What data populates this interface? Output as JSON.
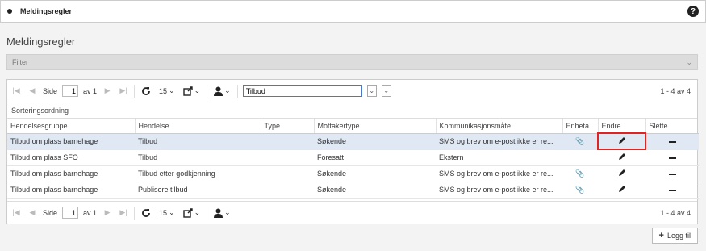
{
  "header": {
    "title": "Meldingsregler",
    "help_label": "?"
  },
  "page_title": "Meldingsregler",
  "filter": {
    "label": "Filter"
  },
  "pager": {
    "side_label": "Side",
    "page_value": "1",
    "of_label": "av 1",
    "page_size": "15",
    "search_value": "Tilbud",
    "count_text": "1 - 4 av 4"
  },
  "sort_label": "Sorteringsordning",
  "columns": [
    "Hendelsesgruppe",
    "Hendelse",
    "Type",
    "Mottakertype",
    "Kommunikasjonsmåte",
    "Enheta...",
    "Endre",
    "Slette"
  ],
  "rows": [
    {
      "group": "Tilbud om plass barnehage",
      "event": "Tilbud",
      "type": "",
      "recipient": "Søkende",
      "comm": "SMS og brev om e-post ikke er re...",
      "selected": true
    },
    {
      "group": "Tilbud om plass SFO",
      "event": "Tilbud",
      "type": "",
      "recipient": "Foresatt",
      "comm": "Ekstern",
      "selected": false
    },
    {
      "group": "Tilbud om plass barnehage",
      "event": "Tilbud etter godkjenning",
      "type": "",
      "recipient": "Søkende",
      "comm": "SMS og brev om e-post ikke er re...",
      "selected": false
    },
    {
      "group": "Tilbud om plass barnehage",
      "event": "Publisere tilbud",
      "type": "",
      "recipient": "Søkende",
      "comm": "SMS og brev om e-post ikke er re...",
      "selected": false
    }
  ],
  "add_button": {
    "label": "Legg til",
    "icon": "plus-icon"
  },
  "icons": {
    "attachment": "paperclip-icon",
    "edit": "pencil-icon",
    "delete": "minus-icon",
    "refresh": "refresh-icon",
    "export": "export-icon",
    "user": "user-icon"
  },
  "colors": {
    "highlight": "#e02424",
    "selected_row": "#dfe8f3",
    "search_border": "#4a78c8"
  }
}
